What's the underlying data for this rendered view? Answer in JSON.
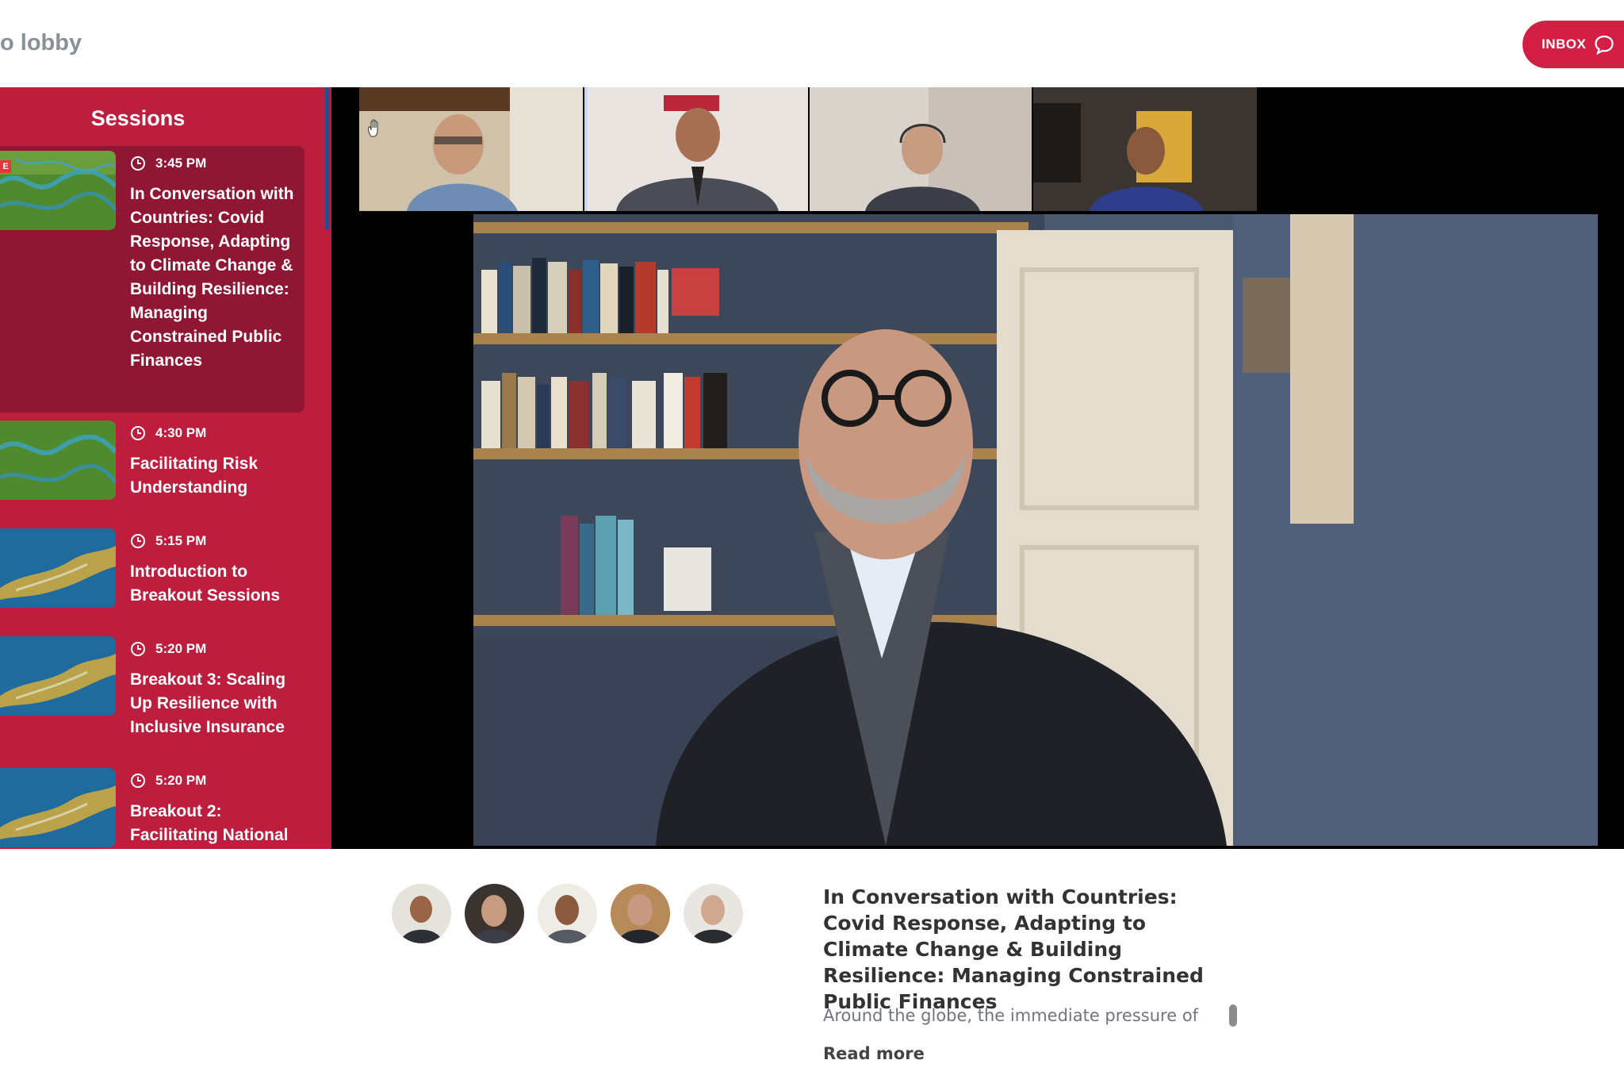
{
  "header": {
    "back_label": "o lobby",
    "inbox_label": "INBOX",
    "inbox_icon": "chat-bubble-icon"
  },
  "sessions": {
    "title": "Sessions",
    "live_tag": "E",
    "items": [
      {
        "time": "3:45 PM",
        "title": "In Conversation with Countries: Covid Response, Adapting to Climate Change & Building Resilience: Managing Constrained Public Finances",
        "thumb": "wetland-aerial",
        "active": true
      },
      {
        "time": "4:30 PM",
        "title": "Facilitating Risk Understanding",
        "thumb": "wetland-aerial"
      },
      {
        "time": "5:15 PM",
        "title": "Introduction to Breakout Sessions",
        "thumb": "island-aerial"
      },
      {
        "time": "5:20 PM",
        "title": "Breakout 3: Scaling Up Resilience with Inclusive Insurance",
        "thumb": "island-aerial"
      },
      {
        "time": "5:20 PM",
        "title": "Breakout 2: Facilitating National",
        "thumb": "island-aerial"
      }
    ]
  },
  "video": {
    "participants": [
      "participant-1",
      "participant-2",
      "participant-3",
      "participant-4"
    ],
    "hand_icon": "raise-hand-icon"
  },
  "event": {
    "title": "In Conversation with Countries: Covid Response, Adapting to Climate Change & Building Resilience: Managing Constrained Public Finances",
    "description": "Around the globe, the immediate pressure of",
    "read_more": "Read more",
    "speakers": [
      "speaker-1",
      "speaker-2",
      "speaker-3",
      "speaker-4",
      "speaker-5"
    ]
  },
  "colors": {
    "brand": "#d41f45",
    "sidebar": "#be1e3e",
    "active_session": "#8f1734"
  }
}
